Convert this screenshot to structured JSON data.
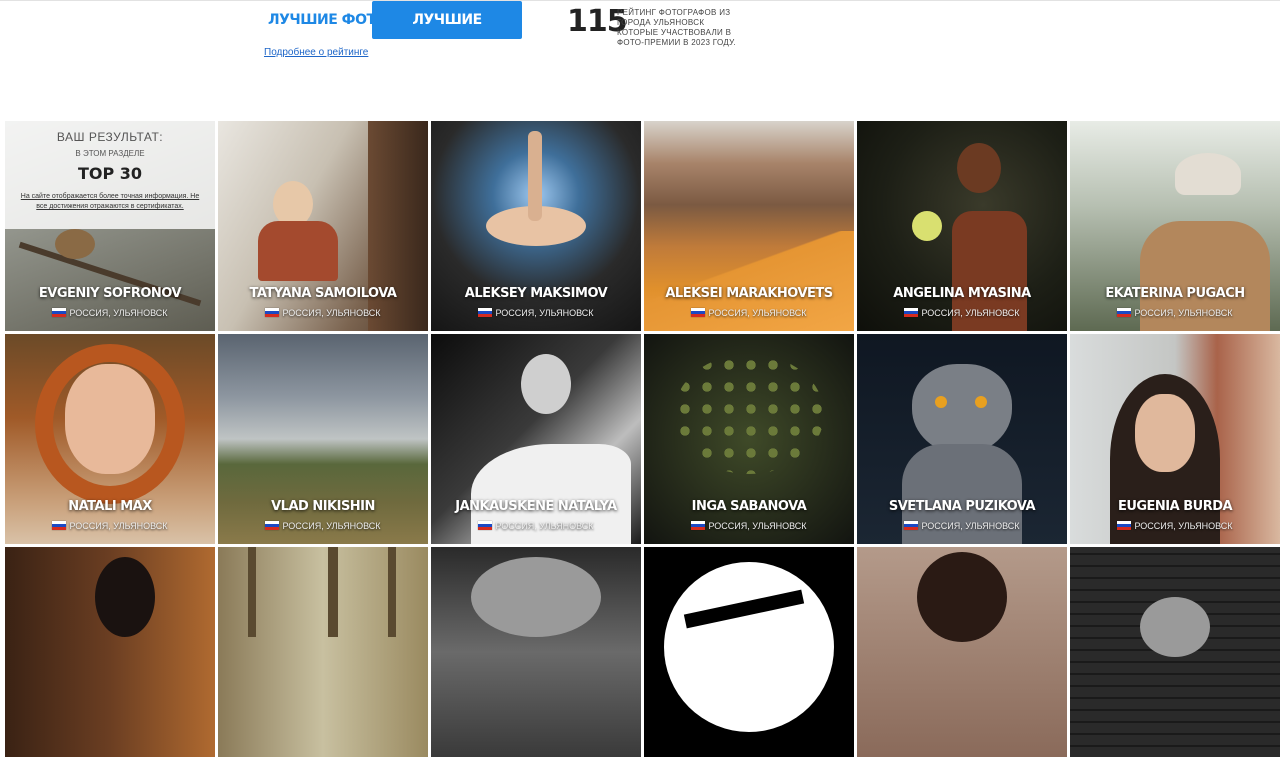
{
  "nav": {
    "tab_best_photo": "ЛУЧШИЕ ФОТО",
    "tab_best_photographers": "ЛУЧШИЕ ФОТОГРАФЫ",
    "more_link": "Подробнее о рейтинге",
    "accent_color": "#1e88e5"
  },
  "rating": {
    "count": "115",
    "description": "РЕЙТИНГ ФОТОГРАФОВ ИЗ ГОРОДА УЛЬЯНОВСК КОТОРЫЕ УЧАСТВОВАЛИ В ФОТО-ПРЕМИИ В 2023 ГОДУ."
  },
  "result": {
    "title": "ВАШ РЕЗУЛЬТАТ:",
    "section": "В ЭТОМ РАЗДЕЛЕ",
    "rank": "TOP 30",
    "note": "На сайте отображается более точная информация. Не все достижения отражаются в сертификатах."
  },
  "photographers": [
    {
      "name": "EVGENIY SOFRONOV",
      "location": "РОССИЯ, УЛЬЯНОВСК"
    },
    {
      "name": "TATYANA SAMOILOVA",
      "location": "РОССИЯ, УЛЬЯНОВСК"
    },
    {
      "name": "ALEKSEY MAKSIMOV",
      "location": "РОССИЯ, УЛЬЯНОВСК"
    },
    {
      "name": "ALEKSEI MARAKHOVETS",
      "location": "РОССИЯ, УЛЬЯНОВСК"
    },
    {
      "name": "ANGELINA MYASINA",
      "location": "РОССИЯ, УЛЬЯНОВСК"
    },
    {
      "name": "EKATERINA PUGACH",
      "location": "РОССИЯ, УЛЬЯНОВСК"
    },
    {
      "name": "NATALI MAX",
      "location": "РОССИЯ, УЛЬЯНОВСК"
    },
    {
      "name": "VLAD NIKISHIN",
      "location": "РОССИЯ, УЛЬЯНОВСК"
    },
    {
      "name": "JANKAUSKENE NATALYA",
      "location": "РОССИЯ, УЛЬЯНОВСК"
    },
    {
      "name": "INGA SABANOVA",
      "location": "РОССИЯ, УЛЬЯНОВСК"
    },
    {
      "name": "SVETLANA PUZIKOVA",
      "location": "РОССИЯ, УЛЬЯНОВСК"
    },
    {
      "name": "EUGENIA BURDA",
      "location": "РОССИЯ, УЛЬЯНОВСК"
    }
  ]
}
